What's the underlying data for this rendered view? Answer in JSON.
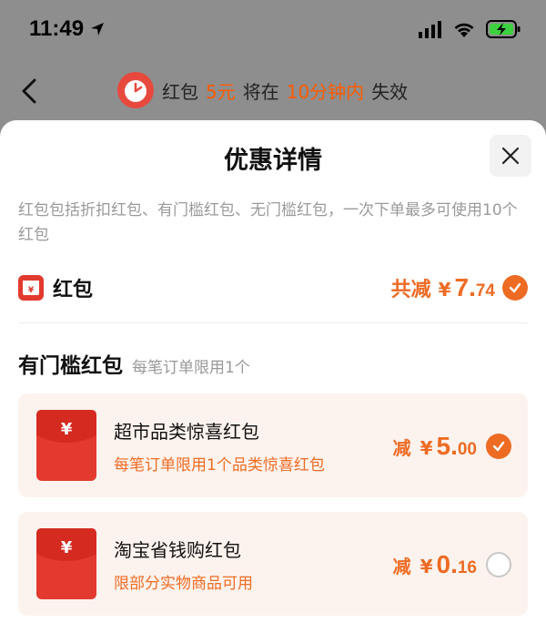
{
  "status_bar": {
    "time": "11:49"
  },
  "header": {
    "banner": {
      "prefix": "红包",
      "amount": "5元",
      "middle": "将在",
      "time": "10分钟内",
      "suffix": "失效"
    }
  },
  "sheet": {
    "title": "优惠详情",
    "description": "红包包括折扣红包、有门槛红包、无门槛红包，一次下单最多可使用10个红包",
    "summary": {
      "icon_glyph": "¥",
      "label": "红包",
      "total_label": "共减",
      "currency": "¥",
      "amount_int": "7.",
      "amount_dec": "74",
      "checked": true
    },
    "section": {
      "title": "有门槛红包",
      "subtitle": "每笔订单限用1个"
    },
    "cards": [
      {
        "icon_glyph": "¥",
        "title": "超市品类惊喜红包",
        "note": "每笔订单限用1个品类惊喜红包",
        "reduce_label": "减",
        "currency": "¥",
        "amount_int": "5.",
        "amount_dec": "00",
        "checked": true
      },
      {
        "icon_glyph": "¥",
        "title": "淘宝省钱购红包",
        "note": "限部分实物商品可用",
        "reduce_label": "减",
        "currency": "¥",
        "amount_int": "0.",
        "amount_dec": "16",
        "checked": false
      }
    ]
  },
  "colors": {
    "accent": "#ee6b24",
    "red_packet": "#e23a2e",
    "card_bg": "#fdf3ee",
    "overlay": "#8e8e8e"
  },
  "icons": [
    "location-arrow-icon",
    "cellular-signal-icon",
    "wifi-icon",
    "battery-charging-icon",
    "back-chevron-icon",
    "alarm-clock-icon",
    "close-icon",
    "red-packet-icon",
    "checkmark-icon"
  ]
}
